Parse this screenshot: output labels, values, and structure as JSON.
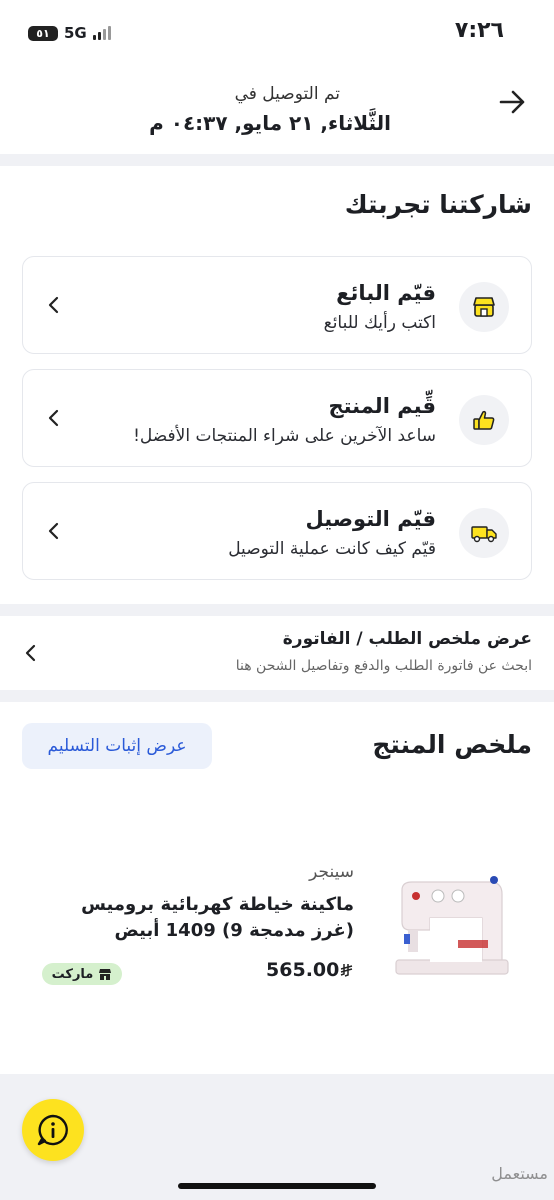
{
  "status_bar": {
    "time": "٧:٢٦",
    "network": "5G",
    "battery": "٥١"
  },
  "header": {
    "delivered_label": "تم التوصيل في",
    "delivered_date": "الثَّلاثاء, ٢١ مايو, ٠٤:٣٧ م"
  },
  "experience": {
    "title": "شاركتنا تجربتك",
    "cards": [
      {
        "title": "قيّم البائع",
        "subtitle": "اكتب رأيك للبائع",
        "icon": "store-icon"
      },
      {
        "title": "قِّيم المنتج",
        "subtitle": "ساعد الآخرين على شراء المنتجات الأفضل!",
        "icon": "thumbs-up-icon"
      },
      {
        "title": "قيّم التوصيل",
        "subtitle": "قيّم كيف كانت عملية التوصيل",
        "icon": "delivery-truck-icon"
      }
    ]
  },
  "invoice": {
    "title": "عرض ملخص الطلب / الفاتورة",
    "subtitle": "ابحث عن فاتورة الطلب والدفع وتفاصيل الشحن هنا"
  },
  "summary": {
    "title": "ملخص المنتج",
    "proof_button": "عرض إثبات التسليم",
    "product": {
      "brand": "سينجر",
      "name": "ماكينة خياطة كهربائية بروميس (غرز مدمجة 9) 1409 أبيض",
      "price": "565.00",
      "market_badge": "ماركت"
    }
  },
  "watermark": "مستعمل",
  "colors": {
    "accent_yellow": "#fde21f",
    "link_blue": "#2a5ad8",
    "market_green": "#d5f0cd"
  }
}
